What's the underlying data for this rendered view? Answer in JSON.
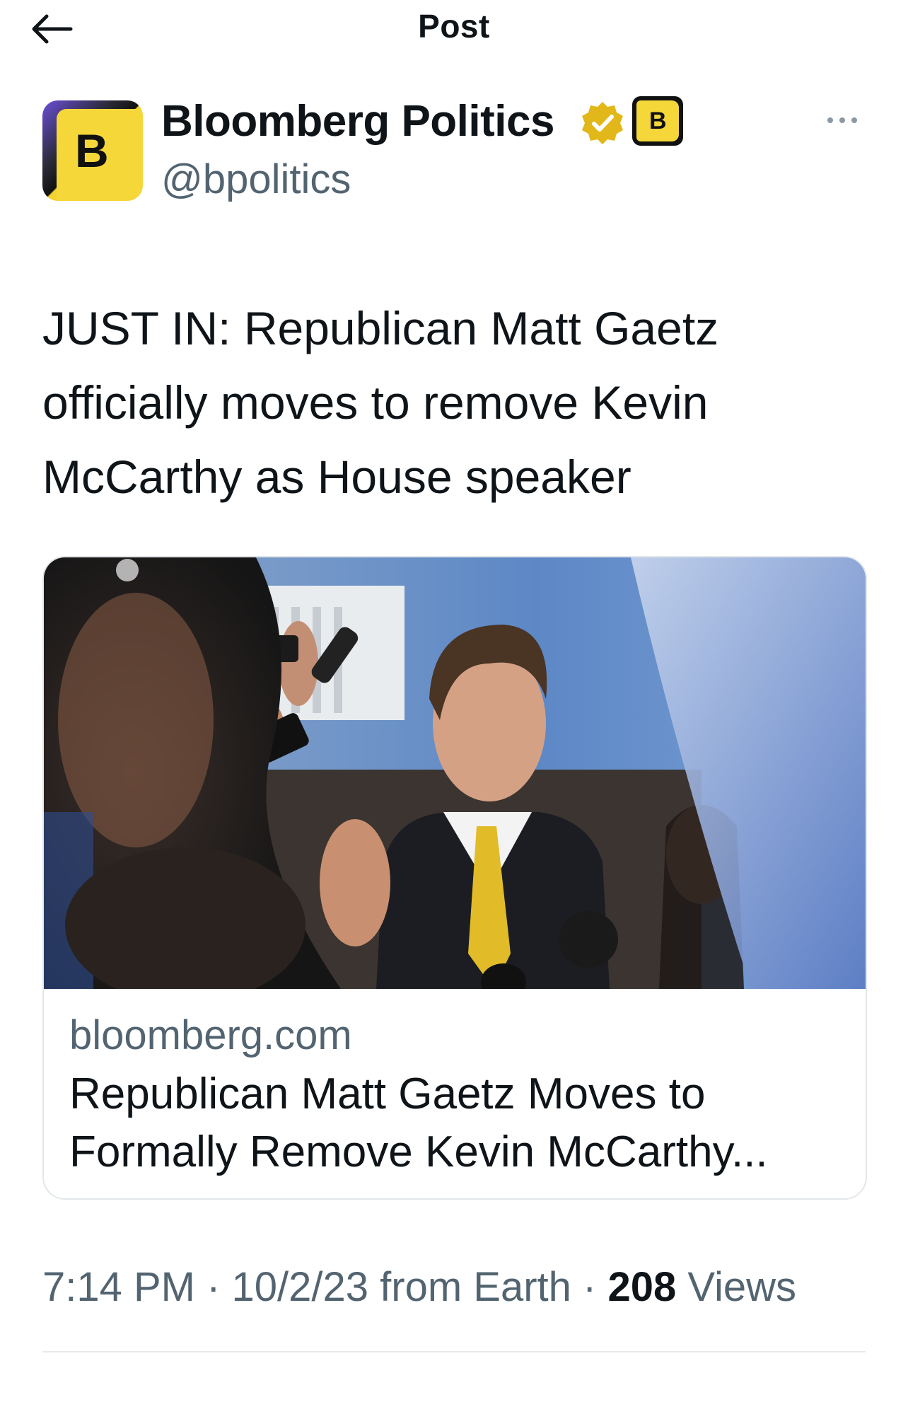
{
  "header": {
    "title": "Post"
  },
  "author": {
    "avatar_letter": "B",
    "name": "Bloomberg Politics",
    "handle": "@bpolitics",
    "affiliate_letter": "B"
  },
  "post": {
    "text": "JUST IN: Republican Matt Gaetz officially moves to remove Kevin McCarthy as House speaker"
  },
  "card": {
    "domain": "bloomberg.com",
    "title": "Republican Matt Gaetz Moves to Formally Remove Kevin McCarthy..."
  },
  "meta": {
    "time": "7:14 PM",
    "separator": " · ",
    "date": "10/2/23",
    "source": " from Earth",
    "views_count": "208",
    "views_label": " Views"
  },
  "colors": {
    "brand_yellow": "#f5d73a",
    "verified_gold": "#e2b719",
    "secondary_text": "#536471"
  }
}
